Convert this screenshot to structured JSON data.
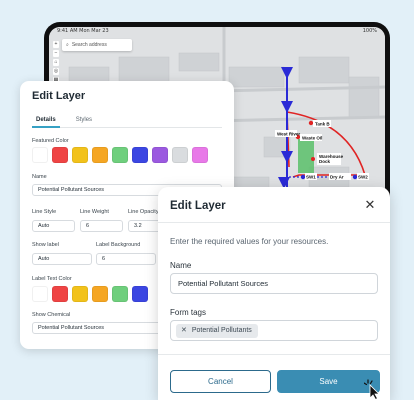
{
  "tablet": {
    "status_left": "9:41 AM Mon Mar 23",
    "status_right": "100%",
    "search_placeholder": "Search address",
    "tools": [
      "+",
      "−",
      "⌂",
      "◎",
      "▦",
      "✎"
    ],
    "map_labels": {
      "tank": "Tank B",
      "waste_oil": "Waste Oil",
      "warehouse": "Warehouse\nDock",
      "west_river": "West River",
      "sw1": "SW1",
      "sw2": "SW2",
      "dryer": "Dry Ar"
    }
  },
  "back_dialog": {
    "title": "Edit Layer",
    "tabs": [
      "Details",
      "Styles"
    ],
    "active_tab": "Details",
    "featured_color_label": "Featured Color",
    "featured_colors": [
      "#ffffff",
      "#ef4444",
      "#f2c21b",
      "#f5a623",
      "#6fcf7d",
      "#3b46e2",
      "#9b59e0",
      "#d9dcdf",
      "#e879e8"
    ],
    "name_label": "Name",
    "name_value": "Potential Pollutant Sources",
    "line_style_label": "Line Style",
    "line_style_value": "Auto",
    "line_weight_label": "Line Weight",
    "line_weight_value": "6",
    "line_opacity_label": "Line Opacity",
    "line_opacity_value": "3.2",
    "show_label_label": "Show label",
    "show_label_value": "Auto",
    "label_background_label": "Label Background",
    "label_background_value": "6",
    "label_text_color_label": "Label Text Color",
    "label_text_colors": [
      "#ffffff",
      "#ef4444",
      "#f2c21b",
      "#f5a623",
      "#6fcf7d",
      "#3b46e2"
    ],
    "show_chemical_label": "Show Chemical",
    "show_chemical_value": "Potential Pollutant Sources"
  },
  "front_dialog": {
    "title": "Edit Layer",
    "instructions": "Enter the required values for your resources.",
    "name_label": "Name",
    "name_value": "Potential Pollutant Sources",
    "form_tags_label": "Form tags",
    "tag": "Potential Pollutants",
    "cancel_label": "Cancel",
    "save_label": "Save"
  },
  "colors": {
    "accent": "#3a8db3",
    "tab_underline": "#36a1c4",
    "map_route_red": "#e02424",
    "map_route_blue": "#2a2ad6"
  }
}
